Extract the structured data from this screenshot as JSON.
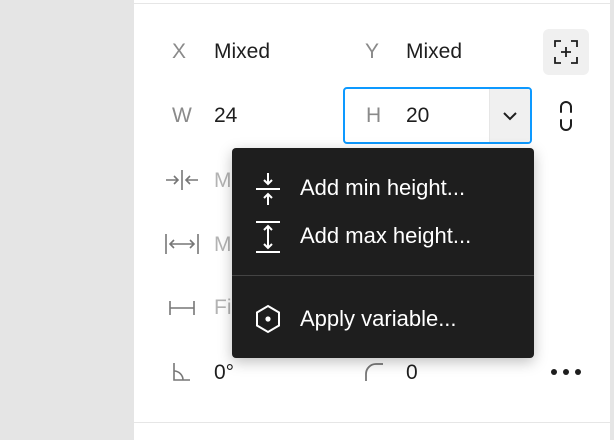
{
  "position": {
    "x_label": "X",
    "x_value": "Mixed",
    "y_label": "Y",
    "y_value": "Mixed"
  },
  "size": {
    "w_label": "W",
    "w_value": "24",
    "h_label": "H",
    "h_value": "20"
  },
  "constraints": {
    "min_row_text": "M",
    "max_row_text": "M",
    "fix_row_text": "Fi"
  },
  "transform": {
    "rotation_value": "0°",
    "radius_value": "0"
  },
  "menu": {
    "items": [
      {
        "label": "Add min height...",
        "icon": "min-height-icon"
      },
      {
        "label": "Add max height...",
        "icon": "max-height-icon"
      },
      {
        "label": "Apply variable...",
        "icon": "variable-hexagon-icon"
      }
    ]
  },
  "colors": {
    "accent": "#0d99ff",
    "menu_bg": "#1e1e1e",
    "panel_bg": "#ffffff",
    "canvas_bg": "#e5e5e5"
  }
}
